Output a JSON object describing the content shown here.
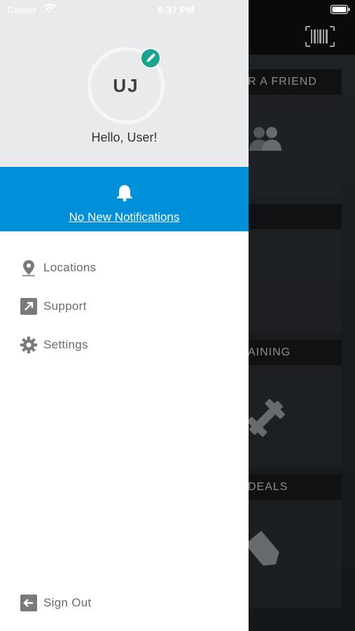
{
  "status_bar": {
    "carrier": "Carrier",
    "time": "6:37 PM"
  },
  "profile": {
    "initials": "UJ",
    "greeting": "Hello, User!"
  },
  "notifications": {
    "label": "No New Notifications"
  },
  "menu": {
    "items": [
      {
        "label": "Locations",
        "icon": "location-pin-icon"
      },
      {
        "label": "Support",
        "icon": "external-link-icon"
      },
      {
        "label": "Settings",
        "icon": "gear-icon"
      }
    ],
    "sign_out": {
      "label": "Sign Out",
      "icon": "sign-out-icon"
    }
  },
  "background_tiles": [
    {
      "label": "R A FRIEND"
    },
    {
      "label": ""
    },
    {
      "label": "AINING"
    },
    {
      "label": "DEALS"
    }
  ],
  "colors": {
    "notification_bar": "#0090d9",
    "edit_badge": "#1aa38f",
    "drawer_header": "#e9eaec"
  }
}
